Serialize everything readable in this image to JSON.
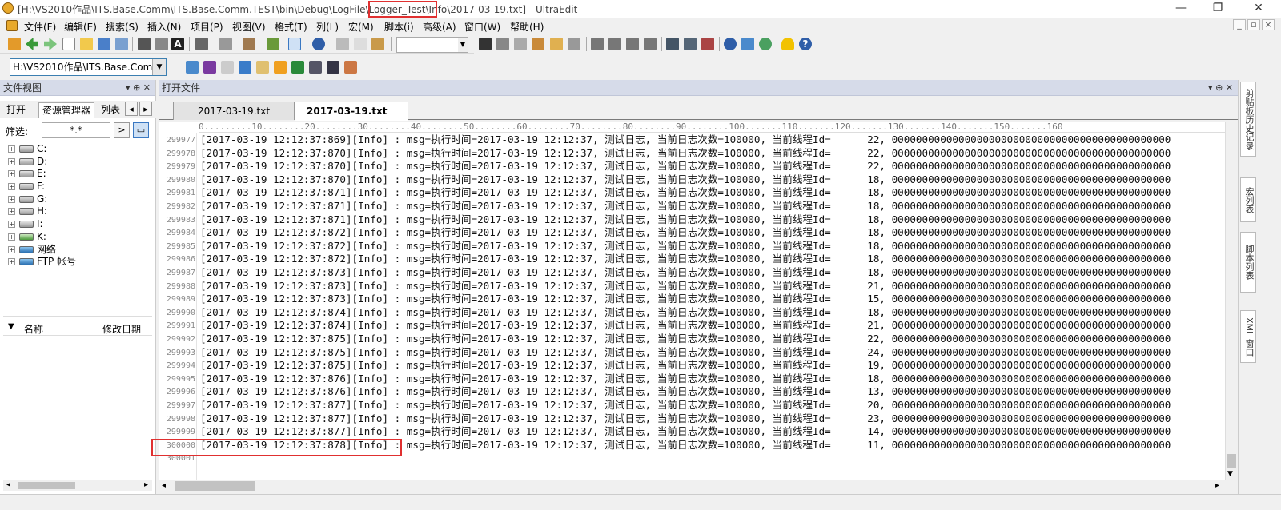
{
  "window": {
    "title": "[H:\\VS2010作品\\ITS.Base.Comm\\ITS.Base.Comm.TEST\\bin\\Debug\\LogFile\\Logger_Test\\Info\\2017-03-19.txt] - UltraEdit",
    "highlighted_segment": "\\Logger_Test\\",
    "minimize": "—",
    "restore": "❐",
    "close": "✕"
  },
  "menu": [
    "文件(F)",
    "编辑(E)",
    "搜索(S)",
    "插入(N)",
    "项目(P)",
    "视图(V)",
    "格式(T)",
    "列(L)",
    "宏(M)",
    "脚本(i)",
    "高级(A)",
    "窗口(W)",
    "帮助(H)"
  ],
  "toolbar2": {
    "path_combo": "H:\\VS2010作品\\ITS.Base.Comm"
  },
  "left_panel": {
    "title": "文件视图",
    "tabs": [
      "打开",
      "资源管理器",
      "列表"
    ],
    "filter_label": "筛选:",
    "filter_value": "*.*",
    "drives": [
      "C:",
      "D:",
      "E:",
      "F:",
      "G:",
      "H:",
      "I:",
      "K:",
      "网络",
      "FTP 帐号"
    ],
    "list_headers": [
      "名称",
      "修改日期"
    ]
  },
  "right_strip": {
    "tabs": [
      "剪贴板历史记录",
      "宏列表",
      "脚本列表",
      "XML 窗口"
    ]
  },
  "editor": {
    "panel_title": "打开文件",
    "tabs": [
      "2017-03-19.txt",
      "2017-03-19.txt"
    ],
    "active_tab_index": 1,
    "close_glyph": "×",
    "ruler": "0.........10........20........30........40........50........60........70........80........90........100.......110.......120.......130.......140.......150.......160",
    "lines": [
      {
        "n": "299977",
        "text": "[2017-03-19 12:12:37:869][Info] : msg=执行时间=2017-03-19 12:12:37, 测试日志, 当前日志次数=100000, 当前线程Id=      22, 0000000000000000000000000000000000000000000000"
      },
      {
        "n": "299978",
        "text": "[2017-03-19 12:12:37:870][Info] : msg=执行时间=2017-03-19 12:12:37, 测试日志, 当前日志次数=100000, 当前线程Id=      22, 0000000000000000000000000000000000000000000000"
      },
      {
        "n": "299979",
        "text": "[2017-03-19 12:12:37:870][Info] : msg=执行时间=2017-03-19 12:12:37, 测试日志, 当前日志次数=100000, 当前线程Id=      22, 0000000000000000000000000000000000000000000000"
      },
      {
        "n": "299980",
        "text": "[2017-03-19 12:12:37:870][Info] : msg=执行时间=2017-03-19 12:12:37, 测试日志, 当前日志次数=100000, 当前线程Id=      18, 0000000000000000000000000000000000000000000000"
      },
      {
        "n": "299981",
        "text": "[2017-03-19 12:12:37:871][Info] : msg=执行时间=2017-03-19 12:12:37, 测试日志, 当前日志次数=100000, 当前线程Id=      18, 0000000000000000000000000000000000000000000000"
      },
      {
        "n": "299982",
        "text": "[2017-03-19 12:12:37:871][Info] : msg=执行时间=2017-03-19 12:12:37, 测试日志, 当前日志次数=100000, 当前线程Id=      18, 0000000000000000000000000000000000000000000000"
      },
      {
        "n": "299983",
        "text": "[2017-03-19 12:12:37:871][Info] : msg=执行时间=2017-03-19 12:12:37, 测试日志, 当前日志次数=100000, 当前线程Id=      18, 0000000000000000000000000000000000000000000000"
      },
      {
        "n": "299984",
        "text": "[2017-03-19 12:12:37:872][Info] : msg=执行时间=2017-03-19 12:12:37, 测试日志, 当前日志次数=100000, 当前线程Id=      18, 0000000000000000000000000000000000000000000000"
      },
      {
        "n": "299985",
        "text": "[2017-03-19 12:12:37:872][Info] : msg=执行时间=2017-03-19 12:12:37, 测试日志, 当前日志次数=100000, 当前线程Id=      18, 0000000000000000000000000000000000000000000000"
      },
      {
        "n": "299986",
        "text": "[2017-03-19 12:12:37:872][Info] : msg=执行时间=2017-03-19 12:12:37, 测试日志, 当前日志次数=100000, 当前线程Id=      18, 0000000000000000000000000000000000000000000000"
      },
      {
        "n": "299987",
        "text": "[2017-03-19 12:12:37:873][Info] : msg=执行时间=2017-03-19 12:12:37, 测试日志, 当前日志次数=100000, 当前线程Id=      18, 0000000000000000000000000000000000000000000000"
      },
      {
        "n": "299988",
        "text": "[2017-03-19 12:12:37:873][Info] : msg=执行时间=2017-03-19 12:12:37, 测试日志, 当前日志次数=100000, 当前线程Id=      21, 0000000000000000000000000000000000000000000000"
      },
      {
        "n": "299989",
        "text": "[2017-03-19 12:12:37:873][Info] : msg=执行时间=2017-03-19 12:12:37, 测试日志, 当前日志次数=100000, 当前线程Id=      15, 0000000000000000000000000000000000000000000000"
      },
      {
        "n": "299990",
        "text": "[2017-03-19 12:12:37:874][Info] : msg=执行时间=2017-03-19 12:12:37, 测试日志, 当前日志次数=100000, 当前线程Id=      18, 0000000000000000000000000000000000000000000000"
      },
      {
        "n": "299991",
        "text": "[2017-03-19 12:12:37:874][Info] : msg=执行时间=2017-03-19 12:12:37, 测试日志, 当前日志次数=100000, 当前线程Id=      21, 0000000000000000000000000000000000000000000000"
      },
      {
        "n": "299992",
        "text": "[2017-03-19 12:12:37:875][Info] : msg=执行时间=2017-03-19 12:12:37, 测试日志, 当前日志次数=100000, 当前线程Id=      22, 0000000000000000000000000000000000000000000000"
      },
      {
        "n": "299993",
        "text": "[2017-03-19 12:12:37:875][Info] : msg=执行时间=2017-03-19 12:12:37, 测试日志, 当前日志次数=100000, 当前线程Id=      24, 0000000000000000000000000000000000000000000000"
      },
      {
        "n": "299994",
        "text": "[2017-03-19 12:12:37:875][Info] : msg=执行时间=2017-03-19 12:12:37, 测试日志, 当前日志次数=100000, 当前线程Id=      19, 0000000000000000000000000000000000000000000000"
      },
      {
        "n": "299995",
        "text": "[2017-03-19 12:12:37:876][Info] : msg=执行时间=2017-03-19 12:12:37, 测试日志, 当前日志次数=100000, 当前线程Id=      18, 0000000000000000000000000000000000000000000000"
      },
      {
        "n": "299996",
        "text": "[2017-03-19 12:12:37:876][Info] : msg=执行时间=2017-03-19 12:12:37, 测试日志, 当前日志次数=100000, 当前线程Id=      13, 0000000000000000000000000000000000000000000000"
      },
      {
        "n": "299997",
        "text": "[2017-03-19 12:12:37:877][Info] : msg=执行时间=2017-03-19 12:12:37, 测试日志, 当前日志次数=100000, 当前线程Id=      20, 0000000000000000000000000000000000000000000000"
      },
      {
        "n": "299998",
        "text": "[2017-03-19 12:12:37:877][Info] : msg=执行时间=2017-03-19 12:12:37, 测试日志, 当前日志次数=100000, 当前线程Id=      23, 0000000000000000000000000000000000000000000000"
      },
      {
        "n": "299999",
        "text": "[2017-03-19 12:12:37:877][Info] : msg=执行时间=2017-03-19 12:12:37, 测试日志, 当前日志次数=100000, 当前线程Id=      14, 0000000000000000000000000000000000000000000000"
      },
      {
        "n": "300000",
        "text": "[2017-03-19 12:12:37:878][Info] : msg=执行时间=2017-03-19 12:12:37, 测试日志, 当前日志次数=100000, 当前线程Id=      11, 0000000000000000000000000000000000000000000000"
      },
      {
        "n": "300001",
        "text": ""
      }
    ]
  },
  "colors": {
    "highlight_box": "#e03030",
    "panel_header": "#d6dbe9"
  }
}
